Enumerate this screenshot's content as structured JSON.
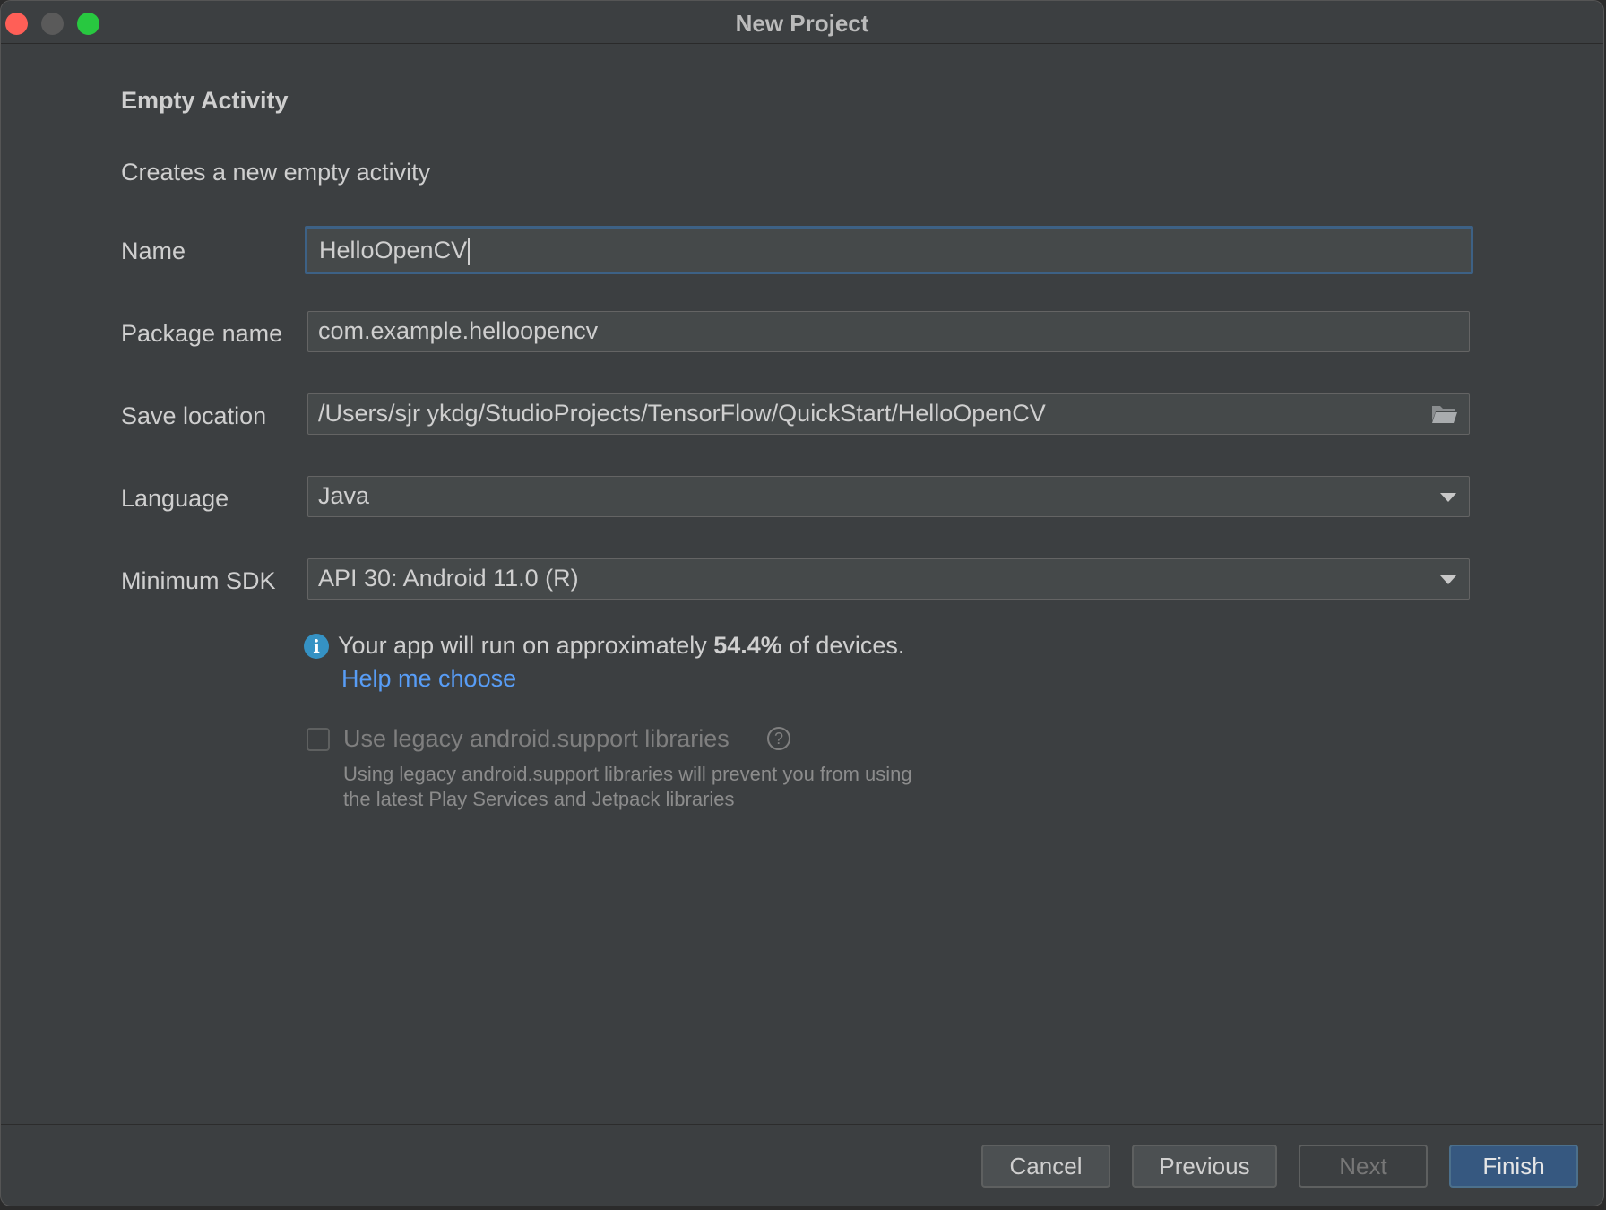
{
  "window": {
    "title": "New Project"
  },
  "page": {
    "heading": "Empty Activity",
    "description": "Creates a new empty activity"
  },
  "form": {
    "name": {
      "label": "Name",
      "value": "HelloOpenCV"
    },
    "package": {
      "label": "Package name",
      "value": "com.example.helloopencv"
    },
    "save_location": {
      "label": "Save location",
      "value": "/Users/sjr ykdg/StudioProjects/TensorFlow/QuickStart/HelloOpenCV",
      "icon": "folder-icon"
    },
    "language": {
      "label": "Language",
      "value": "Java"
    },
    "min_sdk": {
      "label": "Minimum SDK",
      "value": "API 30: Android 11.0 (R)"
    }
  },
  "info": {
    "icon": "info-icon",
    "text_before": "Your app will run on approximately ",
    "percent": "54.4%",
    "text_after": " of devices.",
    "link": "Help me choose"
  },
  "legacy": {
    "checked": false,
    "label": "Use legacy android.support libraries",
    "help_icon": "?",
    "note_line1": "Using legacy android.support libraries will prevent you from using",
    "note_line2": "the latest Play Services and Jetpack libraries"
  },
  "buttons": {
    "cancel": "Cancel",
    "previous": "Previous",
    "next": "Next",
    "finish": "Finish"
  },
  "colors": {
    "background": "#3c3f41",
    "field": "#45494a",
    "focus_border": "#3d6185",
    "link": "#589df6",
    "primary_button": "#365880"
  }
}
